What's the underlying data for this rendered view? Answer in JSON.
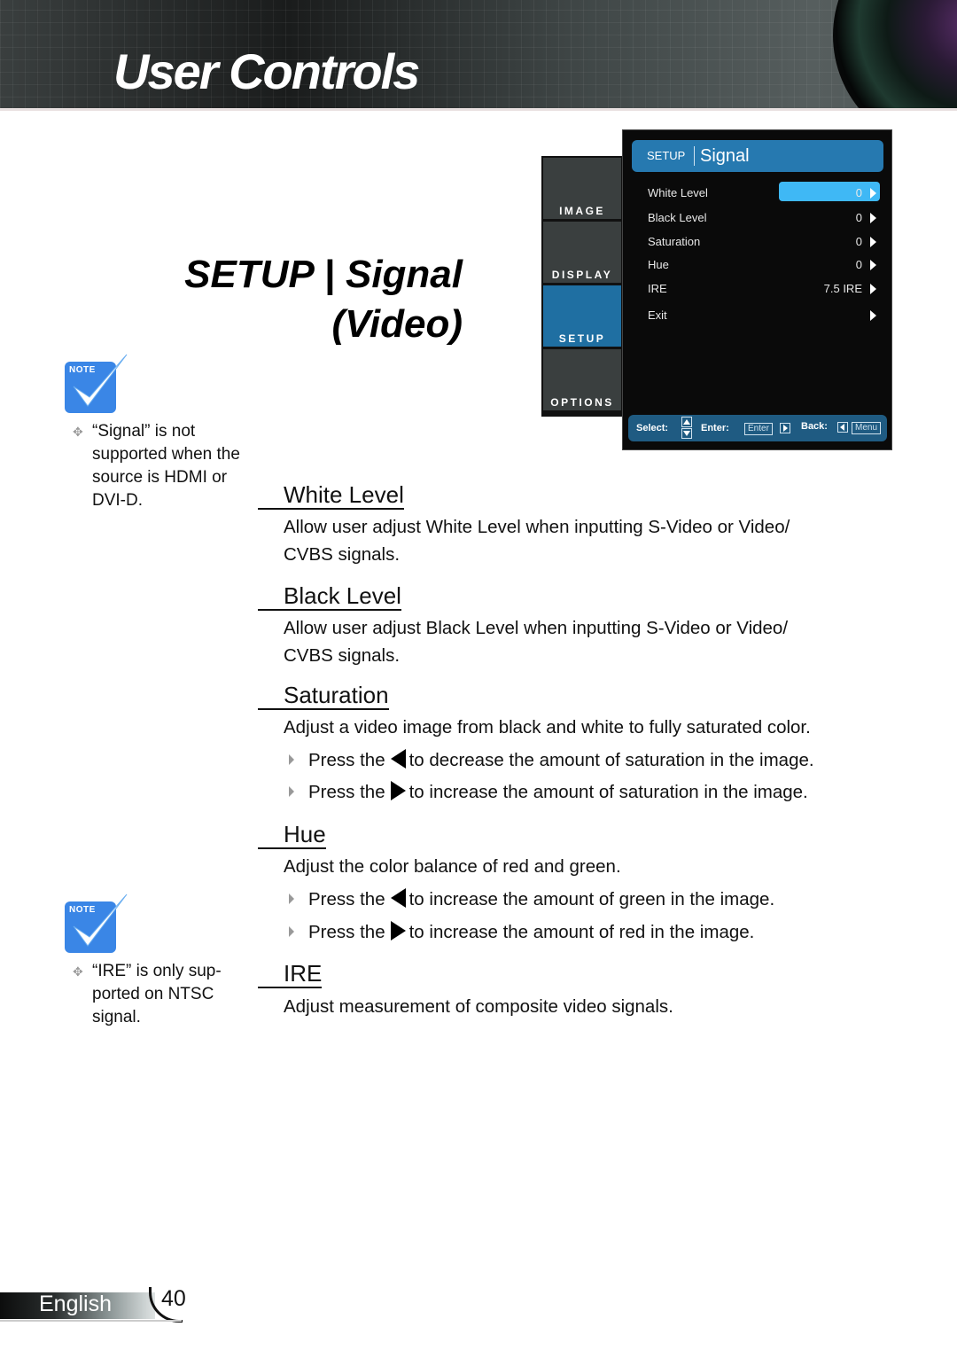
{
  "header": {
    "title": "User Controls"
  },
  "section_title": {
    "line1": "SETUP | Signal",
    "line2": "(Video)"
  },
  "notes": [
    {
      "badge": "NOTE",
      "lines": [
        "“Signal” is not",
        "supported when the",
        "source is HDMI or",
        "DVI-D."
      ]
    },
    {
      "badge": "NOTE",
      "lines": [
        "“IRE” is only sup-",
        "ported on NTSC",
        "signal."
      ]
    }
  ],
  "osd": {
    "tabs": [
      {
        "label": "IMAGE",
        "active": false
      },
      {
        "label": "DISPLAY",
        "active": false
      },
      {
        "label": "SETUP",
        "active": true
      },
      {
        "label": "OPTIONS",
        "active": false
      }
    ],
    "header": {
      "category": "SETUP",
      "submenu": "Signal"
    },
    "rows": [
      {
        "label": "White Level",
        "value": "0",
        "selected": true
      },
      {
        "label": "Black Level",
        "value": "0",
        "selected": false
      },
      {
        "label": "Saturation",
        "value": "0",
        "selected": false
      },
      {
        "label": "Hue",
        "value": "0",
        "selected": false
      },
      {
        "label": "IRE",
        "value": "7.5 IRE",
        "selected": false
      },
      {
        "label": "Exit",
        "value": "",
        "selected": false
      }
    ],
    "footer": {
      "select_label": "Select:",
      "enter_label": "Enter:",
      "enter_key": "Enter",
      "back_label": "Back:",
      "menu_key": "Menu"
    },
    "colors": {
      "header": "#2679b0",
      "selected": "#3fb8f5",
      "active_tab": "#1f6fa2",
      "footer": "#1f5b82"
    }
  },
  "sections": [
    {
      "heading": "White Level",
      "text": [
        "Allow user adjust White Level when inputting S-Video or Video/",
        "CVBS signals."
      ]
    },
    {
      "heading": "Black Level",
      "text": [
        "Allow user adjust Black Level when inputting S-Video or Video/",
        "CVBS signals."
      ]
    },
    {
      "heading": "Saturation",
      "text": [
        "Adjust a video image from black and white to fully saturated color."
      ],
      "bullets": [
        {
          "prefix": "Press the",
          "key": "left",
          "suffix": "to decrease the amount of saturation in the image."
        },
        {
          "prefix": "Press the",
          "key": "right",
          "suffix": "to increase the amount of saturation in the image."
        }
      ]
    },
    {
      "heading": "Hue",
      "text": [
        "Adjust the color balance of red and green."
      ],
      "bullets": [
        {
          "prefix": "Press the",
          "key": "left",
          "suffix": "to increase the amount of green in the image."
        },
        {
          "prefix": "Press the",
          "key": "right",
          "suffix": "to increase the amount of red in the image."
        }
      ]
    },
    {
      "heading": "IRE",
      "text": [
        "Adjust measurement of composite video signals."
      ]
    }
  ],
  "footer": {
    "language": "English",
    "page_number": "40"
  }
}
